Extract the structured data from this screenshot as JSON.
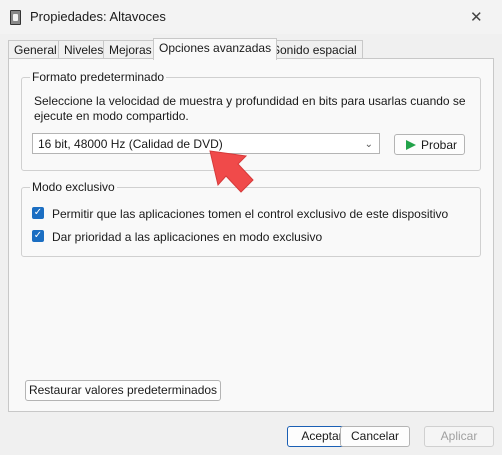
{
  "window": {
    "title": "Propiedades: Altavoces",
    "close_icon": "close-icon"
  },
  "tabs": [
    {
      "label": "General"
    },
    {
      "label": "Niveles"
    },
    {
      "label": "Mejoras"
    },
    {
      "label": "Opciones avanzadas",
      "active": true
    },
    {
      "label": "Sonido espacial"
    }
  ],
  "default_format": {
    "legend": "Formato predeterminado",
    "description": "Seleccione la velocidad de muestra y profundidad en bits para usarlas cuando se ejecute en modo compartido.",
    "selected_value": "16 bit, 48000 Hz (Calidad de DVD)",
    "test_button": "Probar"
  },
  "exclusive_mode": {
    "legend": "Modo exclusivo",
    "options": [
      {
        "label": "Permitir que las aplicaciones tomen el control exclusivo de este dispositivo",
        "checked": true
      },
      {
        "label": "Dar prioridad a las aplicaciones en modo exclusivo",
        "checked": true
      }
    ]
  },
  "restore_button": "Restaurar valores predeterminados",
  "footer": {
    "ok": "Aceptar",
    "cancel": "Cancelar",
    "apply": "Aplicar"
  },
  "colors": {
    "accent": "#1b6ec2",
    "play": "#22a34a",
    "annotation_arrow": "#f04a4a"
  }
}
